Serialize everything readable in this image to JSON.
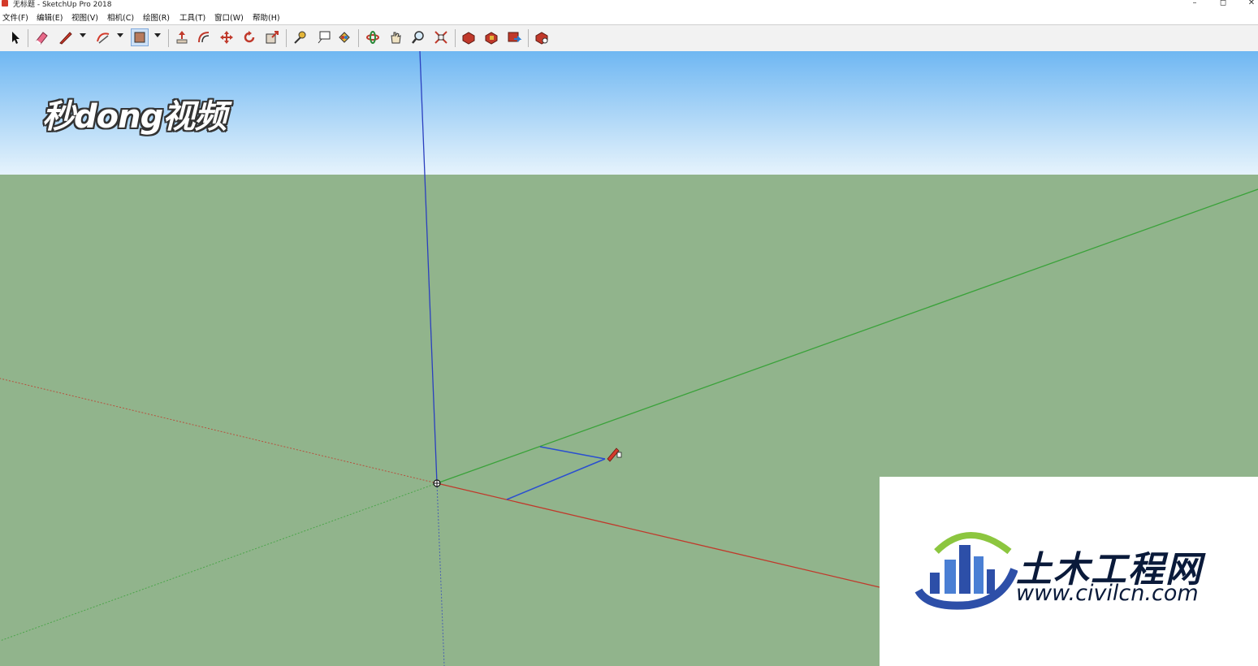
{
  "window": {
    "title": "无标题 - SketchUp Pro 2018",
    "controls": {
      "minimize": "–",
      "restore": "◻",
      "close": "✕"
    }
  },
  "menu": [
    "文件(F)",
    "编辑(E)",
    "视图(V)",
    "相机(C)",
    "绘图(R)",
    "工具(T)",
    "窗口(W)",
    "帮助(H)"
  ],
  "toolbar": {
    "tools": [
      "select-icon",
      "eraser-icon",
      "line-pencil-icon",
      "arc-icon",
      "shape-rectangle-icon",
      "push-pull-icon",
      "offset-icon",
      "move-icon",
      "rotate-icon",
      "scale-icon",
      "tape-measure-icon",
      "text-icon",
      "paint-bucket-icon",
      "orbit-icon",
      "pan-icon",
      "zoom-icon",
      "zoom-extents-icon",
      "3d-warehouse-icon",
      "extension-warehouse-icon",
      "layout-icon",
      "extension-manager-icon"
    ],
    "active_tool": "shape-rectangle-icon"
  },
  "viewport": {
    "sky_top_color": "#6fb7f2",
    "sky_bottom_color": "#e6f3fc",
    "ground_color": "#91b48c",
    "axes": {
      "red": "#c0392b",
      "green": "#3aa23a",
      "blue": "#2a3fbf"
    },
    "sketch_line_color": "#2a4fd0"
  },
  "watermark": {
    "text": "秒dong视频"
  },
  "logo": {
    "name": "土木工程网",
    "url": "www.civilcn.com"
  }
}
